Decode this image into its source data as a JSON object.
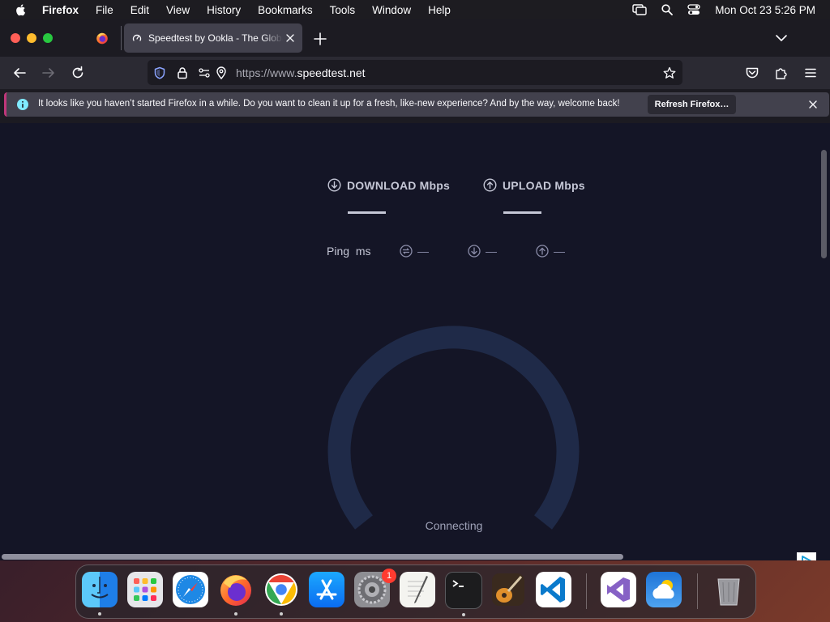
{
  "menubar": {
    "app_name": "Firefox",
    "items": [
      "File",
      "Edit",
      "View",
      "History",
      "Bookmarks",
      "Tools",
      "Window",
      "Help"
    ],
    "datetime": "Mon Oct 23  5:26 PM"
  },
  "browser": {
    "tab_title": "Speedtest by Ookla - The Global Broadband Speed Test",
    "url_prefix": "https://www.",
    "url_domain": "speedtest.net"
  },
  "infobar": {
    "message": "It looks like you haven’t started Firefox in a while. Do you want to clean it up for a fresh, like-new experience? And by the way, welcome back!",
    "button_label": "Refresh Firefox…"
  },
  "speedtest": {
    "download_label": "DOWNLOAD Mbps",
    "upload_label": "UPLOAD Mbps",
    "ping_label": "Ping",
    "ping_unit": "ms",
    "ping_idle": "—",
    "download_idle": "—",
    "upload_idle": "—",
    "status": "Connecting"
  },
  "dock": {
    "items": [
      "Finder",
      "Launchpad",
      "Safari",
      "Firefox",
      "Google Chrome",
      "App Store",
      "System Settings",
      "TextEdit",
      "Terminal",
      "GarageBand",
      "Visual Studio Code",
      "Visual Studio",
      "Weather",
      "Trash"
    ],
    "settings_badge": "1"
  },
  "colors": {
    "page_bg": "#141526",
    "gauge": "#1f2a48",
    "accent_pink": "#c0367a"
  }
}
